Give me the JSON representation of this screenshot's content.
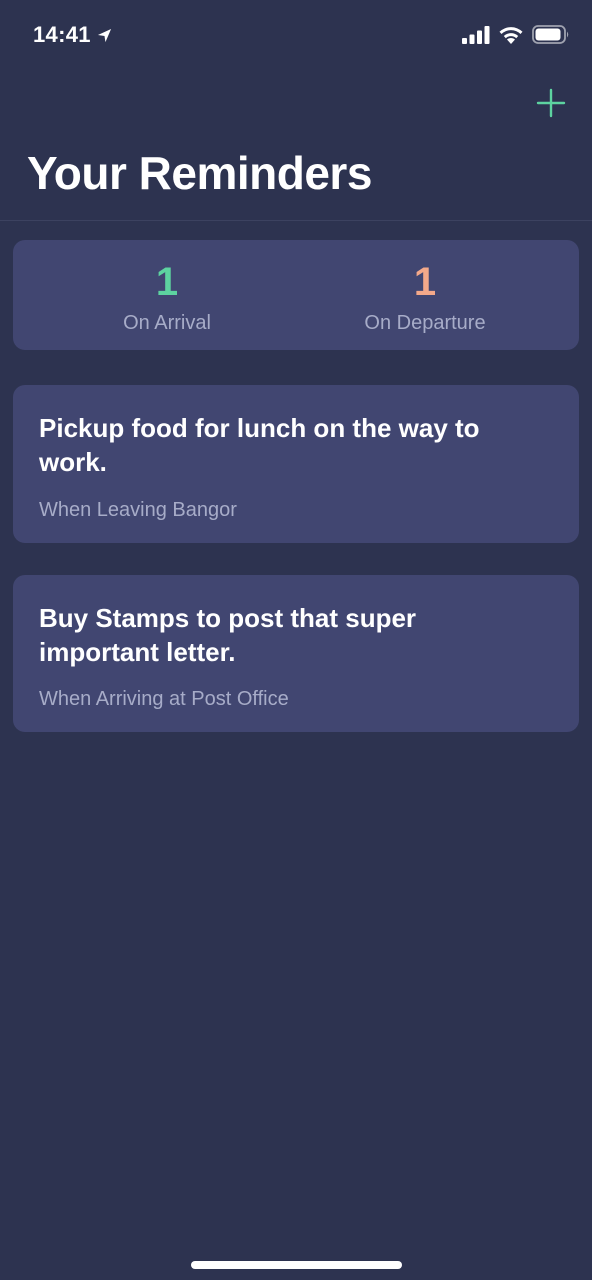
{
  "status_bar": {
    "time": "14:41"
  },
  "header": {
    "title": "Your Reminders"
  },
  "summary": {
    "arrival_count": "1",
    "arrival_label": "On Arrival",
    "departure_count": "1",
    "departure_label": "On Departure"
  },
  "reminders": [
    {
      "text": "Pickup food for lunch on the way to work.",
      "condition": "When Leaving Bangor"
    },
    {
      "text": "Buy Stamps to post that super important letter.",
      "condition": "When Arriving at Post Office"
    }
  ],
  "colors": {
    "background": "#2d3350",
    "card": "#414671",
    "arrival_accent": "#5dd3a0",
    "departure_accent": "#f4a98a",
    "secondary_text": "#a7acc8"
  },
  "icons": {
    "status": [
      "location-arrow-icon",
      "cellular-signal-icon",
      "wifi-icon",
      "battery-icon"
    ],
    "header": [
      "plus-icon"
    ]
  }
}
